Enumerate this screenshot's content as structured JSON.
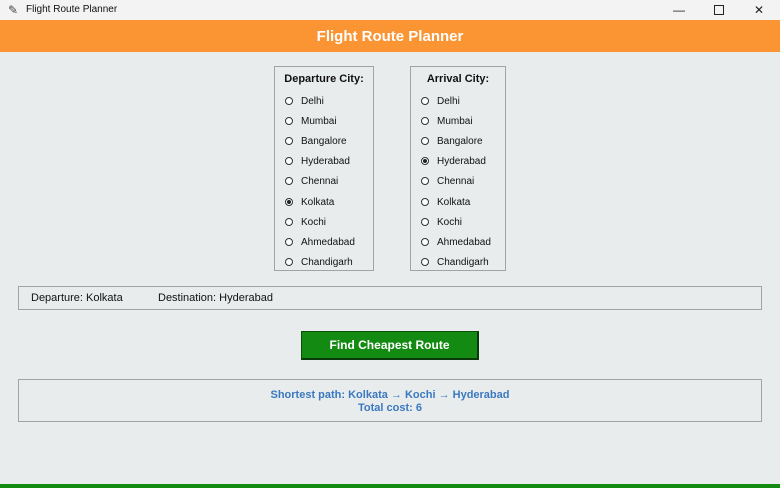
{
  "window": {
    "title": "Flight Route Planner",
    "icon": "feather-icon",
    "controls": {
      "minimize": "—",
      "maximize": "maximize-icon",
      "close": "✕"
    }
  },
  "header": {
    "title": "Flight Route Planner"
  },
  "departure": {
    "label": "Departure City:",
    "options": [
      "Delhi",
      "Mumbai",
      "Bangalore",
      "Hyderabad",
      "Chennai",
      "Kolkata",
      "Kochi",
      "Ahmedabad",
      "Chandigarh"
    ],
    "selected": "Kolkata"
  },
  "arrival": {
    "label": "Arrival City:",
    "options": [
      "Delhi",
      "Mumbai",
      "Bangalore",
      "Hyderabad",
      "Chennai",
      "Kolkata",
      "Kochi",
      "Ahmedabad",
      "Chandigarh"
    ],
    "selected": "Hyderabad"
  },
  "summary": {
    "departure_text": "Departure: Kolkata",
    "destination_text": "Destination: Hyderabad"
  },
  "button": {
    "label": "Find Cheapest Route"
  },
  "result": {
    "path_text": "Shortest path: Kolkata → Kochi → Hyderabad",
    "cost_text": "Total cost: 6"
  },
  "colors": {
    "header": "#fb9533",
    "button": "#138a12",
    "result_text": "#3a79c0",
    "background": "#e9eced"
  }
}
